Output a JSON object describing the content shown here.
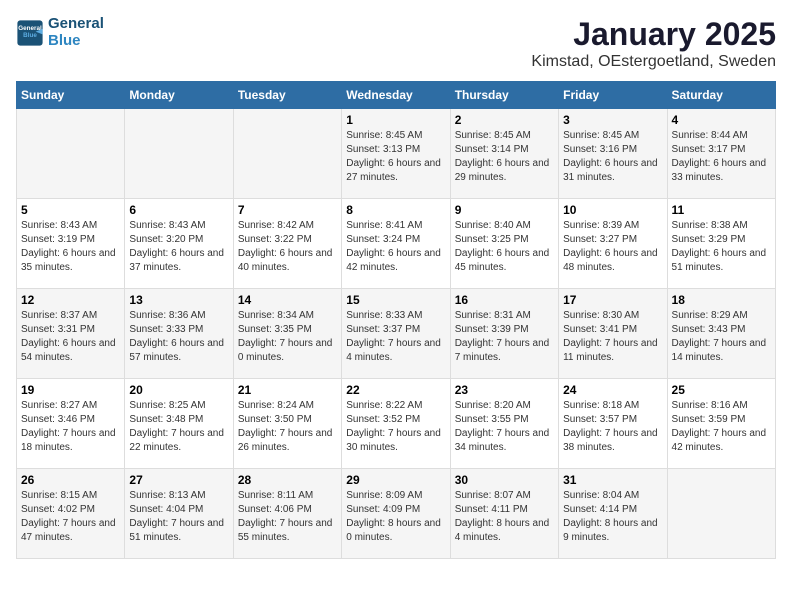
{
  "logo": {
    "line1": "General",
    "line2": "Blue"
  },
  "title": "January 2025",
  "subtitle": "Kimstad, OEstergoetland, Sweden",
  "days_header": [
    "Sunday",
    "Monday",
    "Tuesday",
    "Wednesday",
    "Thursday",
    "Friday",
    "Saturday"
  ],
  "weeks": [
    [
      {
        "day": "",
        "info": ""
      },
      {
        "day": "",
        "info": ""
      },
      {
        "day": "",
        "info": ""
      },
      {
        "day": "1",
        "info": "Sunrise: 8:45 AM\nSunset: 3:13 PM\nDaylight: 6 hours and 27 minutes."
      },
      {
        "day": "2",
        "info": "Sunrise: 8:45 AM\nSunset: 3:14 PM\nDaylight: 6 hours and 29 minutes."
      },
      {
        "day": "3",
        "info": "Sunrise: 8:45 AM\nSunset: 3:16 PM\nDaylight: 6 hours and 31 minutes."
      },
      {
        "day": "4",
        "info": "Sunrise: 8:44 AM\nSunset: 3:17 PM\nDaylight: 6 hours and 33 minutes."
      }
    ],
    [
      {
        "day": "5",
        "info": "Sunrise: 8:43 AM\nSunset: 3:19 PM\nDaylight: 6 hours and 35 minutes."
      },
      {
        "day": "6",
        "info": "Sunrise: 8:43 AM\nSunset: 3:20 PM\nDaylight: 6 hours and 37 minutes."
      },
      {
        "day": "7",
        "info": "Sunrise: 8:42 AM\nSunset: 3:22 PM\nDaylight: 6 hours and 40 minutes."
      },
      {
        "day": "8",
        "info": "Sunrise: 8:41 AM\nSunset: 3:24 PM\nDaylight: 6 hours and 42 minutes."
      },
      {
        "day": "9",
        "info": "Sunrise: 8:40 AM\nSunset: 3:25 PM\nDaylight: 6 hours and 45 minutes."
      },
      {
        "day": "10",
        "info": "Sunrise: 8:39 AM\nSunset: 3:27 PM\nDaylight: 6 hours and 48 minutes."
      },
      {
        "day": "11",
        "info": "Sunrise: 8:38 AM\nSunset: 3:29 PM\nDaylight: 6 hours and 51 minutes."
      }
    ],
    [
      {
        "day": "12",
        "info": "Sunrise: 8:37 AM\nSunset: 3:31 PM\nDaylight: 6 hours and 54 minutes."
      },
      {
        "day": "13",
        "info": "Sunrise: 8:36 AM\nSunset: 3:33 PM\nDaylight: 6 hours and 57 minutes."
      },
      {
        "day": "14",
        "info": "Sunrise: 8:34 AM\nSunset: 3:35 PM\nDaylight: 7 hours and 0 minutes."
      },
      {
        "day": "15",
        "info": "Sunrise: 8:33 AM\nSunset: 3:37 PM\nDaylight: 7 hours and 4 minutes."
      },
      {
        "day": "16",
        "info": "Sunrise: 8:31 AM\nSunset: 3:39 PM\nDaylight: 7 hours and 7 minutes."
      },
      {
        "day": "17",
        "info": "Sunrise: 8:30 AM\nSunset: 3:41 PM\nDaylight: 7 hours and 11 minutes."
      },
      {
        "day": "18",
        "info": "Sunrise: 8:29 AM\nSunset: 3:43 PM\nDaylight: 7 hours and 14 minutes."
      }
    ],
    [
      {
        "day": "19",
        "info": "Sunrise: 8:27 AM\nSunset: 3:46 PM\nDaylight: 7 hours and 18 minutes."
      },
      {
        "day": "20",
        "info": "Sunrise: 8:25 AM\nSunset: 3:48 PM\nDaylight: 7 hours and 22 minutes."
      },
      {
        "day": "21",
        "info": "Sunrise: 8:24 AM\nSunset: 3:50 PM\nDaylight: 7 hours and 26 minutes."
      },
      {
        "day": "22",
        "info": "Sunrise: 8:22 AM\nSunset: 3:52 PM\nDaylight: 7 hours and 30 minutes."
      },
      {
        "day": "23",
        "info": "Sunrise: 8:20 AM\nSunset: 3:55 PM\nDaylight: 7 hours and 34 minutes."
      },
      {
        "day": "24",
        "info": "Sunrise: 8:18 AM\nSunset: 3:57 PM\nDaylight: 7 hours and 38 minutes."
      },
      {
        "day": "25",
        "info": "Sunrise: 8:16 AM\nSunset: 3:59 PM\nDaylight: 7 hours and 42 minutes."
      }
    ],
    [
      {
        "day": "26",
        "info": "Sunrise: 8:15 AM\nSunset: 4:02 PM\nDaylight: 7 hours and 47 minutes."
      },
      {
        "day": "27",
        "info": "Sunrise: 8:13 AM\nSunset: 4:04 PM\nDaylight: 7 hours and 51 minutes."
      },
      {
        "day": "28",
        "info": "Sunrise: 8:11 AM\nSunset: 4:06 PM\nDaylight: 7 hours and 55 minutes."
      },
      {
        "day": "29",
        "info": "Sunrise: 8:09 AM\nSunset: 4:09 PM\nDaylight: 8 hours and 0 minutes."
      },
      {
        "day": "30",
        "info": "Sunrise: 8:07 AM\nSunset: 4:11 PM\nDaylight: 8 hours and 4 minutes."
      },
      {
        "day": "31",
        "info": "Sunrise: 8:04 AM\nSunset: 4:14 PM\nDaylight: 8 hours and 9 minutes."
      },
      {
        "day": "",
        "info": ""
      }
    ]
  ]
}
